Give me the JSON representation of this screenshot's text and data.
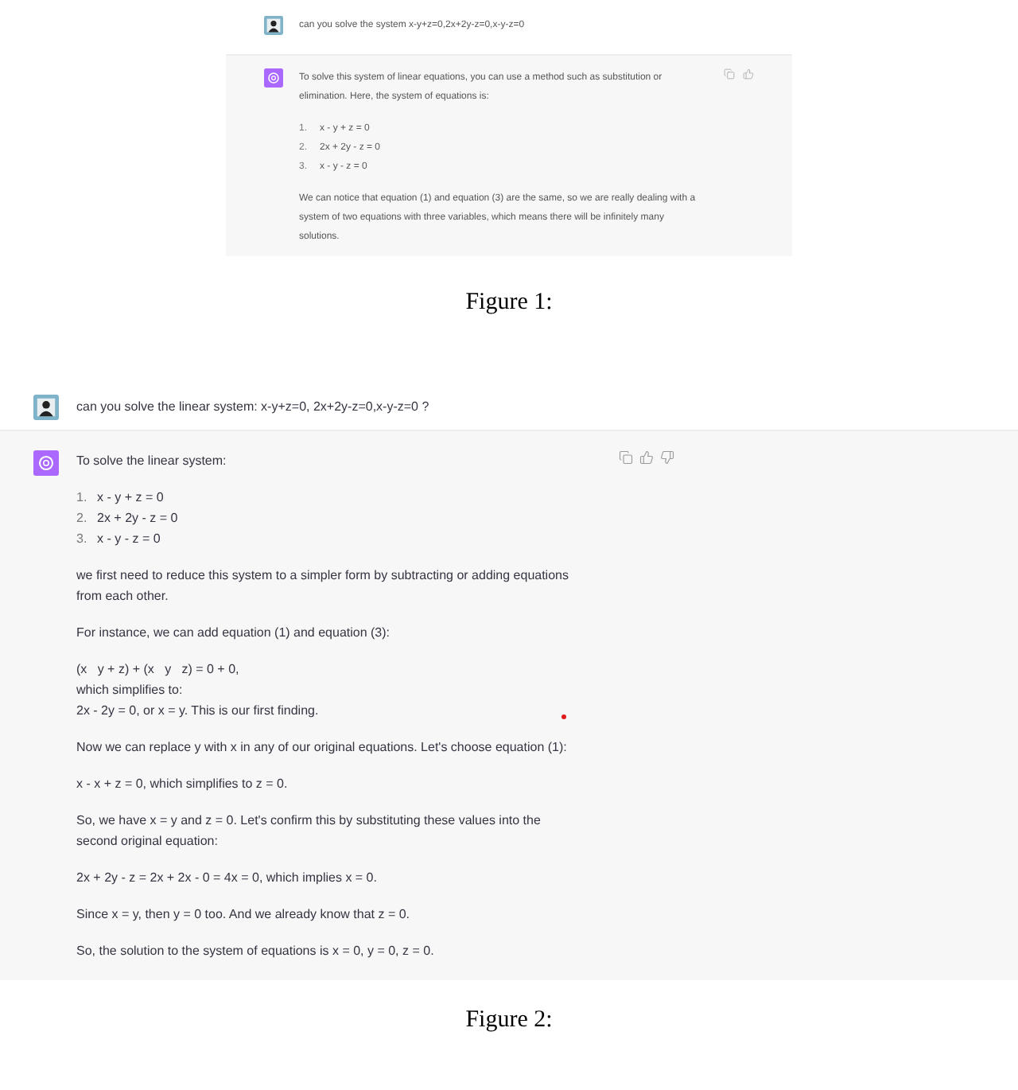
{
  "figures": [
    {
      "messages": [
        {
          "kind": "user",
          "text": "can you solve the system x-y+z=0,2x+2y-z=0,x-y-z=0"
        },
        {
          "kind": "assistant",
          "blocks": [
            {
              "kind": "p",
              "text": "To solve this system of linear equations, you can use a method such as substitution or elimination. Here, the system of equations is:"
            },
            {
              "kind": "ol",
              "items": [
                {
                  "number": "1.",
                  "text": "x - y + z = 0"
                },
                {
                  "number": "2.",
                  "text": "2x + 2y - z = 0"
                },
                {
                  "number": "3.",
                  "text": "x - y - z = 0"
                }
              ]
            },
            {
              "kind": "p",
              "text": "We can notice that equation (1) and equation (3) are the same, so we are really dealing with a system of two equations with three variables, which means there will be infinitely many solutions."
            }
          ]
        }
      ],
      "caption": "Figure 1:"
    },
    {
      "messages": [
        {
          "kind": "user",
          "text": "can you solve the linear system: x-y+z=0, 2x+2y-z=0,x-y-z=0 ?"
        },
        {
          "kind": "assistant",
          "blocks": [
            {
              "kind": "p",
              "text": "To solve the linear system:"
            },
            {
              "kind": "ol",
              "items": [
                {
                  "number": "1.",
                  "text": "x - y + z = 0"
                },
                {
                  "number": "2.",
                  "text": "2x + 2y - z = 0"
                },
                {
                  "number": "3.",
                  "text": "x - y - z = 0"
                }
              ]
            },
            {
              "kind": "p",
              "text": "we first need to reduce this system to a simpler form by subtracting or adding equations from each other."
            },
            {
              "kind": "p",
              "text": "For instance, we can add equation (1) and equation (3):"
            },
            {
              "kind": "lines",
              "lines": [
                "(x   y + z) + (x   y   z) = 0 + 0,",
                "which simplifies to:",
                "2x - 2y = 0, or x = y. This is our first finding."
              ]
            },
            {
              "kind": "p",
              "text": "Now we can replace y with x in any of our original equations. Let's choose equation (1):"
            },
            {
              "kind": "p",
              "text": "x - x + z = 0, which simplifies to z = 0."
            },
            {
              "kind": "p",
              "text": "So, we have x = y and z = 0. Let's confirm this by substituting these values into the second original equation:"
            },
            {
              "kind": "p",
              "text": "2x + 2y - z = 2x + 2x - 0 = 4x = 0, which implies x = 0."
            },
            {
              "kind": "p",
              "text": "Since x = y, then y = 0 too. And we already know that z = 0."
            },
            {
              "kind": "p",
              "text": "So, the solution to the system of equations is x = 0, y = 0, z = 0."
            }
          ]
        }
      ],
      "caption": "Figure 2:"
    }
  ]
}
